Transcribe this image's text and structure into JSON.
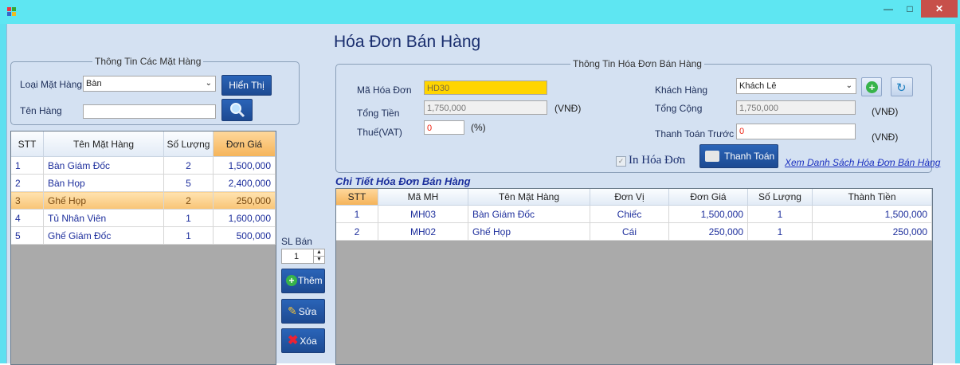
{
  "window": {
    "minimize_glyph": "—",
    "maximize_glyph": "□",
    "close_glyph": "✕"
  },
  "header": {
    "title": "Hóa Đơn Bán Hàng"
  },
  "items_group": {
    "legend": "Thông Tin Các Mặt Hàng",
    "category_label": "Loại Mặt Hàng",
    "category_value": "Bàn",
    "show_button": "Hiển Thị",
    "name_label": "Tên Hàng",
    "name_value": ""
  },
  "items_grid": {
    "columns": [
      "STT",
      "Tên Mặt Hàng",
      "Số Lượng",
      "Đơn Giá"
    ],
    "rows": [
      [
        "1",
        "Bàn Giám Đốc",
        "2",
        "1,500,000"
      ],
      [
        "2",
        "Bàn Họp",
        "5",
        "2,400,000"
      ],
      [
        "3",
        "Ghế Họp",
        "2",
        "250,000"
      ],
      [
        "4",
        "Tủ Nhân Viên",
        "1",
        "1,600,000"
      ],
      [
        "5",
        "Ghế Giám Đốc",
        "1",
        "500,000"
      ]
    ],
    "selected_row": 3,
    "selected_column": "Đơn Giá"
  },
  "actions": {
    "quantity_label": "SL Bán",
    "quantity_value": "1",
    "add": "Thêm",
    "edit": "Sửa",
    "delete": "Xóa"
  },
  "invoice_group": {
    "legend": "Thông Tin Hóa Đơn Bán Hàng",
    "invoice_id_label": "Mã Hóa Đơn",
    "invoice_id_value": "HD30",
    "total_label": "Tổng Tiền",
    "total_value": "1,750,000",
    "total_unit": "(VNĐ)",
    "tax_label": "Thuế(VAT)",
    "tax_value": "0",
    "tax_unit": "(%)",
    "customer_label": "Khách Hàng",
    "customer_value": "Khách Lẻ",
    "sum_label": "Tổng Cộng",
    "sum_value": "1,750,000",
    "sum_unit": "(VNĐ)",
    "prepay_label": "Thanh Toán Trước",
    "prepay_value": "0",
    "prepay_unit": "(VNĐ)",
    "print_label": "In Hóa Đơn",
    "print_checked": true,
    "pay_button": "Thanh Toán",
    "list_link": "Xem Danh Sách Hóa Đơn Bán Hàng"
  },
  "details": {
    "title": "Chi Tiết Hóa Đơn Bán Hàng",
    "columns": [
      "STT",
      "Mã MH",
      "Tên Mặt Hàng",
      "Đơn Vị",
      "Đơn Giá",
      "Số Lượng",
      "Thành Tiền"
    ],
    "rows": [
      [
        "1",
        "MH03",
        "Bàn Giám Đốc",
        "Chiếc",
        "1,500,000",
        "1",
        "1,500,000"
      ],
      [
        "2",
        "MH02",
        "Ghế Họp",
        "Cái",
        "250,000",
        "1",
        "250,000"
      ]
    ]
  },
  "colors": {
    "accent": "#1d4a92",
    "highlight": "#ffd500",
    "selected_row": "#f8c476",
    "link": "#1a2fbf"
  }
}
